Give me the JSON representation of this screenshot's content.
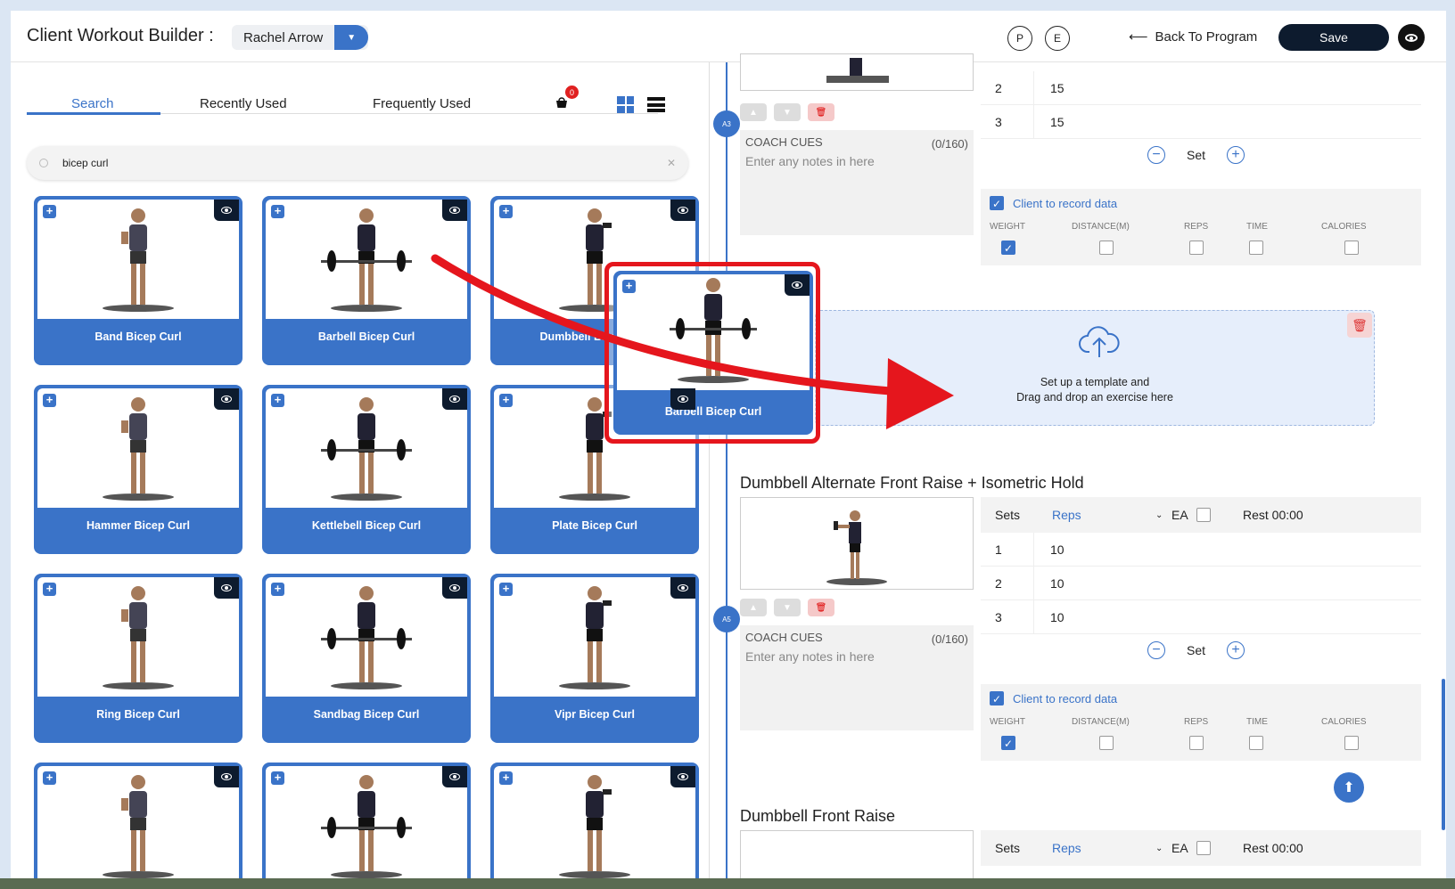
{
  "header": {
    "title": "Client Workout Builder :",
    "client_name": "Rachel Arrow",
    "undo_p": "P",
    "undo_e": "E",
    "back_label": "Back To Program",
    "save_label": "Save"
  },
  "library": {
    "tabs": [
      "Search",
      "Recently Used",
      "Frequently Used"
    ],
    "active_tab": "Search",
    "basket_count": "0",
    "search_value": "bicep curl",
    "exercises": [
      {
        "label": "Band Bicep Curl"
      },
      {
        "label": "Barbell Bicep Curl"
      },
      {
        "label": "Dumbbell Bicep Curl"
      },
      {
        "label": "Hammer Bicep Curl"
      },
      {
        "label": "Kettlebell Bicep Curl"
      },
      {
        "label": "Plate Bicep Curl"
      },
      {
        "label": "Ring Bicep Curl"
      },
      {
        "label": "Sandbag Bicep Curl"
      },
      {
        "label": "Vipr Bicep Curl"
      },
      {
        "label": ""
      },
      {
        "label": ""
      },
      {
        "label": ""
      }
    ]
  },
  "dragged": {
    "label": "Barbell Bicep Curl"
  },
  "workout": {
    "block_a3": {
      "node": "A3",
      "rows": [
        {
          "n": "2",
          "v": "15"
        },
        {
          "n": "3",
          "v": "15"
        }
      ],
      "set_label": "Set",
      "cues_title": "COACH CUES",
      "cues_count": "(0/160)",
      "cues_placeholder": "Enter any notes in here",
      "record_label": "Client to record data",
      "metrics": [
        "WEIGHT",
        "DISTANCE(M)",
        "REPS",
        "TIME",
        "CALORIES"
      ]
    },
    "dropzone": {
      "line1": "Set up a template and",
      "line2": "Drag and drop an exercise here"
    },
    "block_a5": {
      "node": "A5",
      "title": "Dumbbell Alternate Front Raise + Isometric Hold",
      "sets_header": "Sets",
      "reps_header": "Reps",
      "ea_label": "EA",
      "rest_label": "Rest 00:00",
      "rows": [
        {
          "n": "1",
          "v": "10"
        },
        {
          "n": "2",
          "v": "10"
        },
        {
          "n": "3",
          "v": "10"
        }
      ],
      "set_label": "Set",
      "cues_title": "COACH CUES",
      "cues_count": "(0/160)",
      "cues_placeholder": "Enter any notes in here",
      "record_label": "Client to record data",
      "metrics": [
        "WEIGHT",
        "DISTANCE(M)",
        "REPS",
        "TIME",
        "CALORIES"
      ]
    },
    "block_next": {
      "title": "Dumbbell Front Raise",
      "sets_header": "Sets",
      "reps_header": "Reps",
      "ea_label": "EA",
      "rest_label": "Rest 00:00"
    }
  },
  "colors": {
    "accent": "#3a73c8",
    "dark": "#0d1b2e",
    "highlight": "#e5161d"
  }
}
